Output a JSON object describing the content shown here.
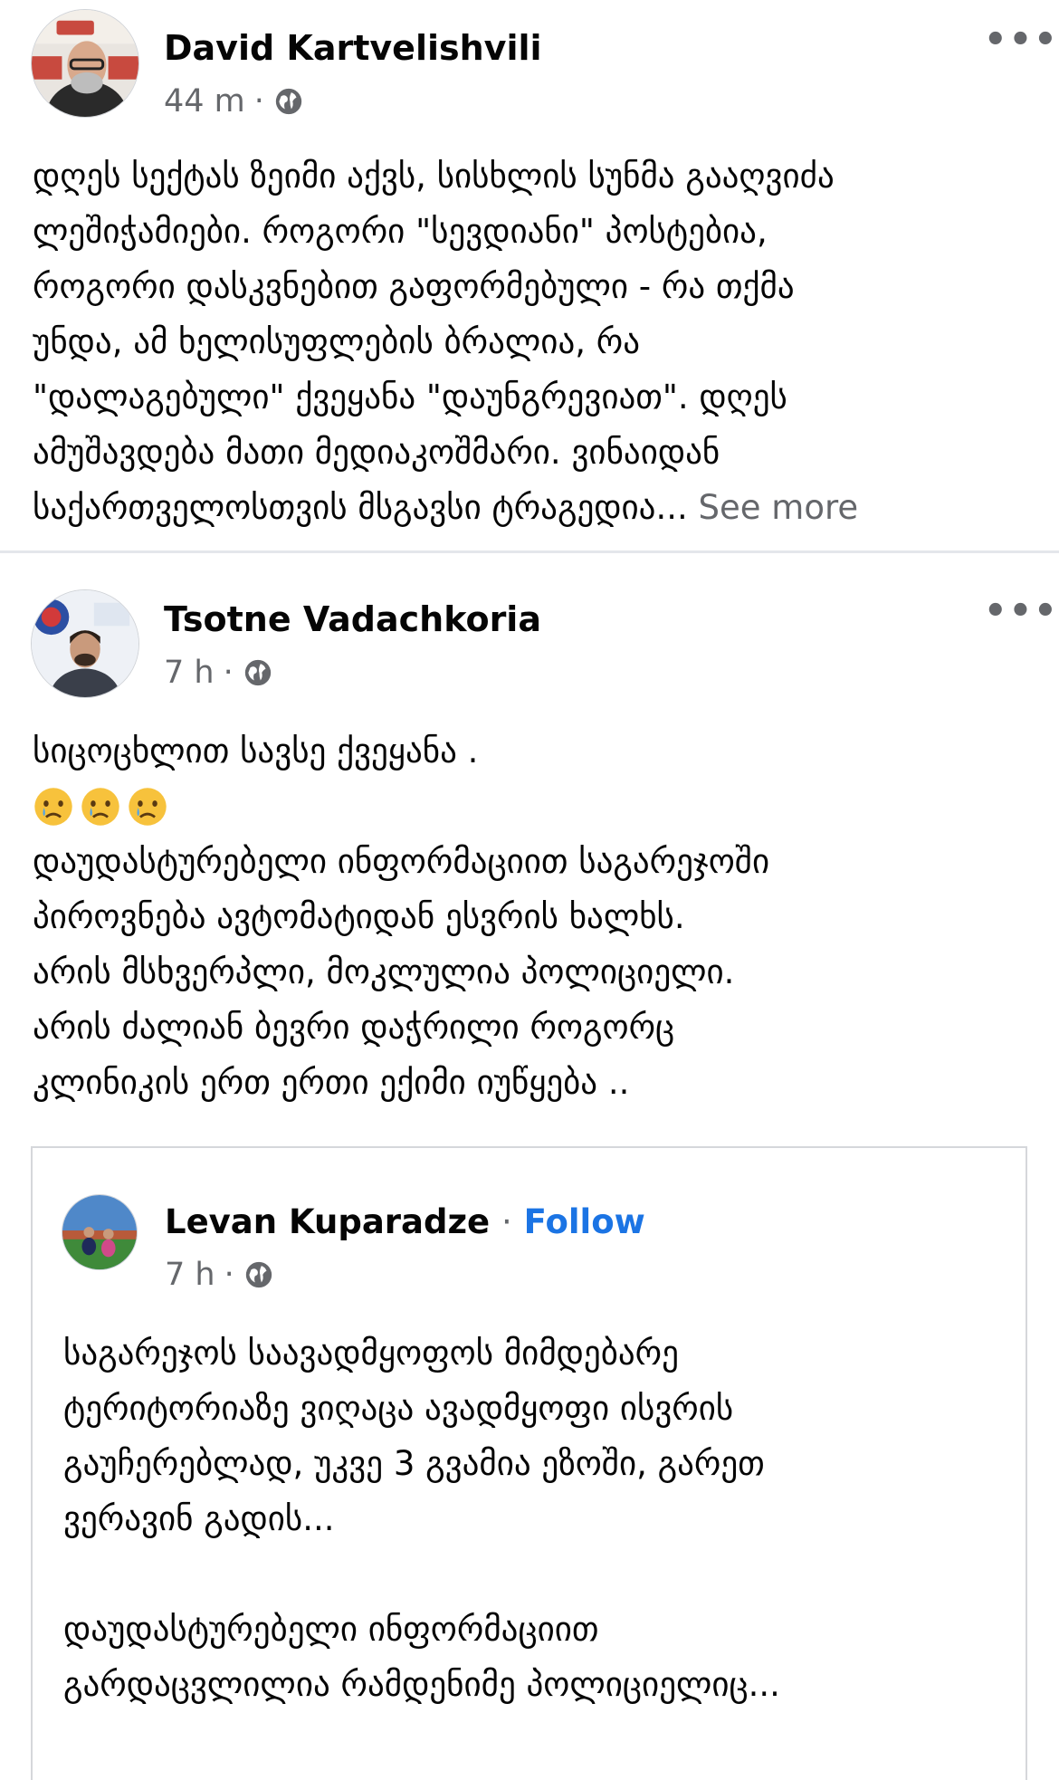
{
  "posts": [
    {
      "author": "David Kartvelishvili",
      "time": "44 m",
      "more_label": "•••",
      "body_lines": [
        "დღეს სექტას ზეიმი აქვს, სისხლის სუნმა გააღვიძა",
        "ლეშიჭამიები. როგორი \"სევდიანი\" პოსტებია,",
        "როგორი დასკვნებით გაფორმებული - რა თქმა",
        "უნდა, ამ ხელისუფლების ბრალია, რა",
        "\"დალაგებული\" ქვეყანა \"დაუნგრევიათ\". დღეს",
        "ამუშავდება მათი მედიაკოშმარი. ვინაიდან",
        "საქართველოსთვის მსგავსი ტრაგედია..."
      ],
      "see_more": "See more",
      "icons": {
        "avatar": "avatar-photo",
        "audience": "globe-icon",
        "menu": "more-options-icon"
      }
    },
    {
      "author": "Tsotne Vadachkoria",
      "time": "7 h",
      "more_label": "•••",
      "body_lines_top": [
        "სიცოცხლით სავსე ქვეყანა ."
      ],
      "emojis": [
        "crying-face-icon",
        "crying-face-icon",
        "crying-face-icon"
      ],
      "body_lines": [
        "დაუდასტურებელი ინფორმაციით საგარეჯოში",
        "პიროვნება ავტომატიდან ესვრის ხალხს.",
        "არის მსხვერპლი, მოკლულია პოლიციელი.",
        "არის ძალიან ბევრი დაჭრილი როგორც",
        "კლინიკის ერთ ერთი ექიმი იუწყება .."
      ],
      "shared": {
        "author": "Levan Kuparadze",
        "separator": "·",
        "follow": "Follow",
        "time": "7 h",
        "body_lines": [
          "საგარეჯოს საავადმყოფოს მიმდებარე",
          "ტერიტორიაზე ვიღაცა ავადმყოფი ისვრის",
          "გაუჩერებლად, უკვე 3 გვამია ეზოში, გარეთ",
          "ვერავინ გადის...",
          "",
          "დაუდასტურებელი ინფორმაციით",
          "გარდაცვლილია რამდენიმე პოლიციელიც..."
        ]
      }
    }
  ],
  "colors": {
    "text": "#050505",
    "secondary": "#65676b",
    "link": "#1b74e4",
    "divider": "#e4e6eb"
  }
}
